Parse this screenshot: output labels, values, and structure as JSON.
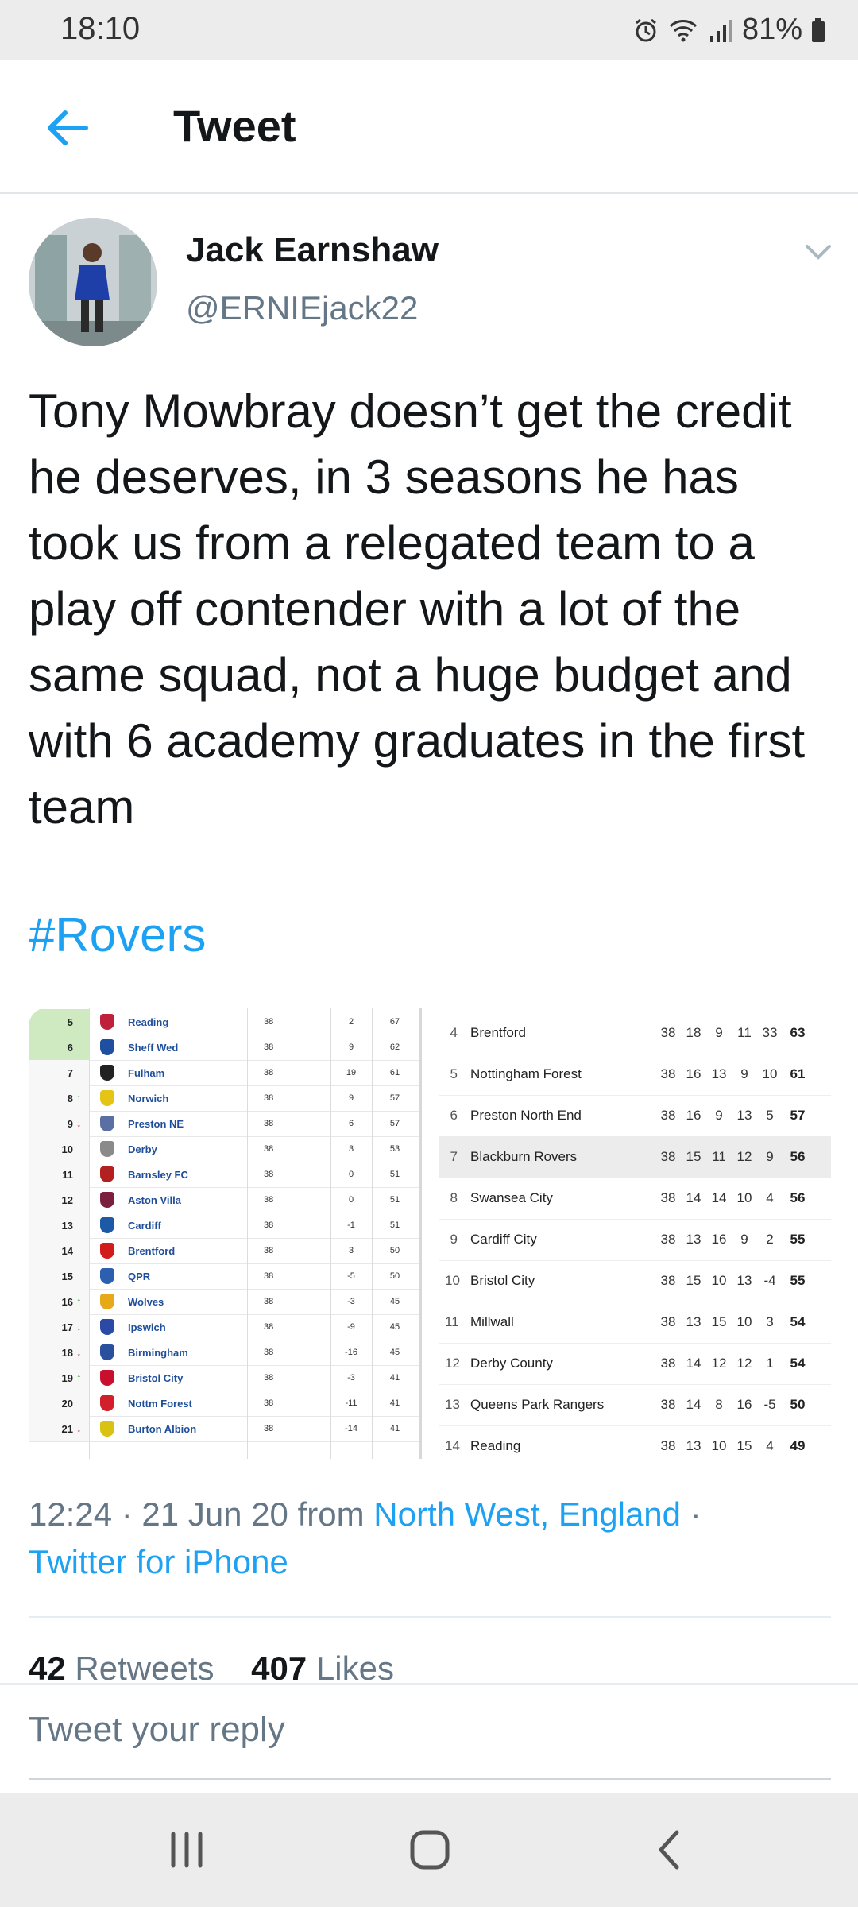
{
  "status_bar": {
    "time": "18:10",
    "battery": "81%",
    "icons": [
      "alarm-icon",
      "wifi-icon",
      "signal-icon",
      "battery-icon"
    ]
  },
  "header": {
    "title": "Tweet"
  },
  "tweet": {
    "author_name": "Jack Earnshaw",
    "author_handle": "@ERNIEjack22",
    "text": "Tony Mowbray doesn’t get the credit he deserves, in 3 seasons he has took us from a relegated team to a play off contender with a lot of the same squad, not a huge budget and with 6 academy graduates in the first team",
    "hashtag": "#Rovers",
    "time": "12:24 · 21 Jun 20 from ",
    "location": "North West, England",
    "separator": " ·",
    "client": "Twitter for iPhone",
    "retweets_count": "42",
    "retweets_label": "Retweets",
    "likes_count": "407",
    "likes_label": "Likes"
  },
  "media": {
    "left_table": [
      {
        "pos": "5",
        "marker": "",
        "team": "Reading",
        "played": "38",
        "gd": "2",
        "pts": "67",
        "crest": "#c0213a"
      },
      {
        "pos": "6",
        "marker": "",
        "team": "Sheff Wed",
        "played": "38",
        "gd": "9",
        "pts": "62",
        "crest": "#1f4fa0"
      },
      {
        "pos": "7",
        "marker": "",
        "team": "Fulham",
        "played": "38",
        "gd": "19",
        "pts": "61",
        "crest": "#222222"
      },
      {
        "pos": "8",
        "marker": "↑",
        "team": "Norwich",
        "played": "38",
        "gd": "9",
        "pts": "57",
        "crest": "#e6c416"
      },
      {
        "pos": "9",
        "marker": "↓",
        "team": "Preston NE",
        "played": "38",
        "gd": "6",
        "pts": "57",
        "crest": "#5a6fa3"
      },
      {
        "pos": "10",
        "marker": "",
        "team": "Derby",
        "played": "38",
        "gd": "3",
        "pts": "53",
        "crest": "#8a8a8a"
      },
      {
        "pos": "11",
        "marker": "",
        "team": "Barnsley FC",
        "played": "38",
        "gd": "0",
        "pts": "51",
        "crest": "#b32020"
      },
      {
        "pos": "12",
        "marker": "",
        "team": "Aston Villa",
        "played": "38",
        "gd": "0",
        "pts": "51",
        "crest": "#7a1f3d"
      },
      {
        "pos": "13",
        "marker": "",
        "team": "Cardiff",
        "played": "38",
        "gd": "-1",
        "pts": "51",
        "crest": "#1c5aa8"
      },
      {
        "pos": "14",
        "marker": "",
        "team": "Brentford",
        "played": "38",
        "gd": "3",
        "pts": "50",
        "crest": "#d21b1b"
      },
      {
        "pos": "15",
        "marker": "",
        "team": "QPR",
        "played": "38",
        "gd": "-5",
        "pts": "50",
        "crest": "#2d5fb0"
      },
      {
        "pos": "16",
        "marker": "↑",
        "team": "Wolves",
        "played": "38",
        "gd": "-3",
        "pts": "45",
        "crest": "#e7a81a"
      },
      {
        "pos": "17",
        "marker": "↓",
        "team": "Ipswich",
        "played": "38",
        "gd": "-9",
        "pts": "45",
        "crest": "#2b4aa6"
      },
      {
        "pos": "18",
        "marker": "↓",
        "team": "Birmingham",
        "played": "38",
        "gd": "-16",
        "pts": "45",
        "crest": "#2a4f9c"
      },
      {
        "pos": "19",
        "marker": "↑",
        "team": "Bristol City",
        "played": "38",
        "gd": "-3",
        "pts": "41",
        "crest": "#c8102e"
      },
      {
        "pos": "20",
        "marker": "",
        "team": "Nottm Forest",
        "played": "38",
        "gd": "-11",
        "pts": "41",
        "crest": "#d11f2b"
      },
      {
        "pos": "21",
        "marker": "↓",
        "team": "Burton Albion",
        "played": "38",
        "gd": "-14",
        "pts": "41",
        "crest": "#d8c312"
      }
    ],
    "right_table": [
      {
        "pos": "4",
        "team": "Brentford",
        "p": "38",
        "w": "18",
        "d": "9",
        "l": "11",
        "gd": "33",
        "pts": "63"
      },
      {
        "pos": "5",
        "team": "Nottingham Forest",
        "p": "38",
        "w": "16",
        "d": "13",
        "l": "9",
        "gd": "10",
        "pts": "61"
      },
      {
        "pos": "6",
        "team": "Preston North End",
        "p": "38",
        "w": "16",
        "d": "9",
        "l": "13",
        "gd": "5",
        "pts": "57"
      },
      {
        "pos": "7",
        "team": "Blackburn Rovers",
        "p": "38",
        "w": "15",
        "d": "11",
        "l": "12",
        "gd": "9",
        "pts": "56"
      },
      {
        "pos": "8",
        "team": "Swansea City",
        "p": "38",
        "w": "14",
        "d": "14",
        "l": "10",
        "gd": "4",
        "pts": "56"
      },
      {
        "pos": "9",
        "team": "Cardiff City",
        "p": "38",
        "w": "13",
        "d": "16",
        "l": "9",
        "gd": "2",
        "pts": "55"
      },
      {
        "pos": "10",
        "team": "Bristol City",
        "p": "38",
        "w": "15",
        "d": "10",
        "l": "13",
        "gd": "-4",
        "pts": "55"
      },
      {
        "pos": "11",
        "team": "Millwall",
        "p": "38",
        "w": "13",
        "d": "15",
        "l": "10",
        "gd": "3",
        "pts": "54"
      },
      {
        "pos": "12",
        "team": "Derby County",
        "p": "38",
        "w": "14",
        "d": "12",
        "l": "12",
        "gd": "1",
        "pts": "54"
      },
      {
        "pos": "13",
        "team": "Queens Park Rangers",
        "p": "38",
        "w": "14",
        "d": "8",
        "l": "16",
        "gd": "-5",
        "pts": "50"
      },
      {
        "pos": "14",
        "team": "Reading",
        "p": "38",
        "w": "13",
        "d": "10",
        "l": "15",
        "gd": "4",
        "pts": "49"
      }
    ],
    "highlight_team": "Blackburn Rovers"
  },
  "reply": {
    "placeholder": "Tweet your reply"
  },
  "colors": {
    "link": "#1da1f2",
    "muted": "#657786",
    "text": "#14171a",
    "playoff_green": "#cfe9c0",
    "arrow_up": "#2e9b2e",
    "arrow_down": "#d32f2f"
  }
}
